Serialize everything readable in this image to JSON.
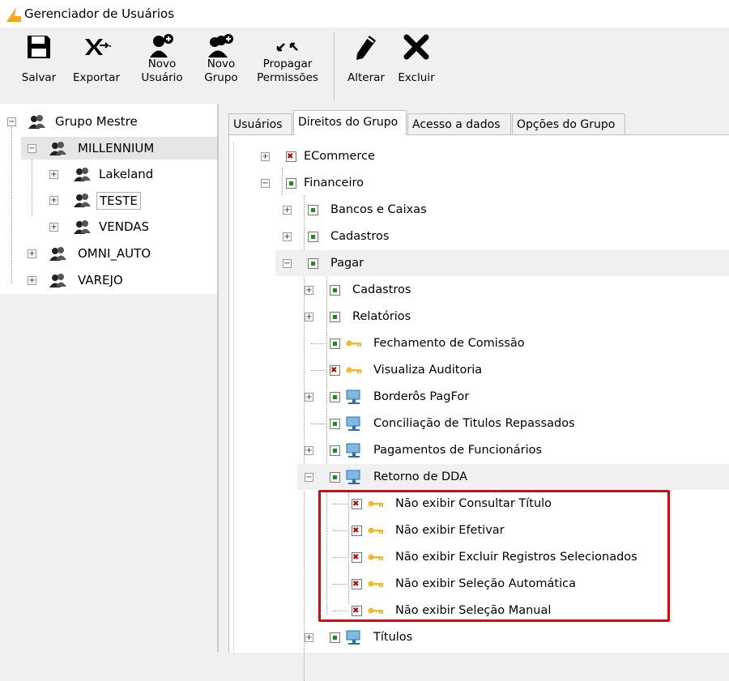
{
  "window": {
    "title": "Gerenciador de Usuários"
  },
  "toolbar": {
    "save": "Salvar",
    "export": "Exportar",
    "new_user_1": "Novo",
    "new_user_2": "Usuário",
    "new_group_1": "Novo",
    "new_group_2": "Grupo",
    "propagate_1": "Propagar",
    "propagate_2": "Permissões",
    "edit": "Alterar",
    "delete": "Excluir"
  },
  "group_tree": {
    "root": "Grupo Mestre",
    "millennium": "MILLENNIUM",
    "lakeland": "Lakeland",
    "teste": "TESTE",
    "vendas": "VENDAS",
    "omni_auto": "OMNI_AUTO",
    "varejo": "VAREJO"
  },
  "tabs": [
    "Usuários",
    "Direitos do Grupo",
    "Acesso a dados",
    "Opções do Grupo"
  ],
  "rights": {
    "ecommerce": "ECommerce",
    "financeiro": "Financeiro",
    "bancos": "Bancos e Caixas",
    "cadastros": "Cadastros",
    "pagar": "Pagar",
    "pagar_cadastros": "Cadastros",
    "relatorios": "Relatórios",
    "fechamento": "Fechamento de Comissão",
    "auditoria": "Visualiza Auditoria",
    "borderos": "Borderôs PagFor",
    "conciliacao": "Conciliação de Titulos Repassados",
    "pagamentos": "Pagamentos de Funcionários",
    "retorno": "Retorno de DDA",
    "consultar": "Não exibir Consultar Título",
    "efetivar": "Não exibir Efetivar",
    "excluir_reg": "Não exibir Excluir Registros Selecionados",
    "sel_auto": "Não exibir Seleção Automática",
    "sel_manual": "Não exibir Seleção Manual",
    "titulos": "Títulos"
  },
  "colors": {
    "granted": "#1e8a1e",
    "denied": "#c00000",
    "highlight": "#ee0000",
    "key": "#f2b92a"
  }
}
